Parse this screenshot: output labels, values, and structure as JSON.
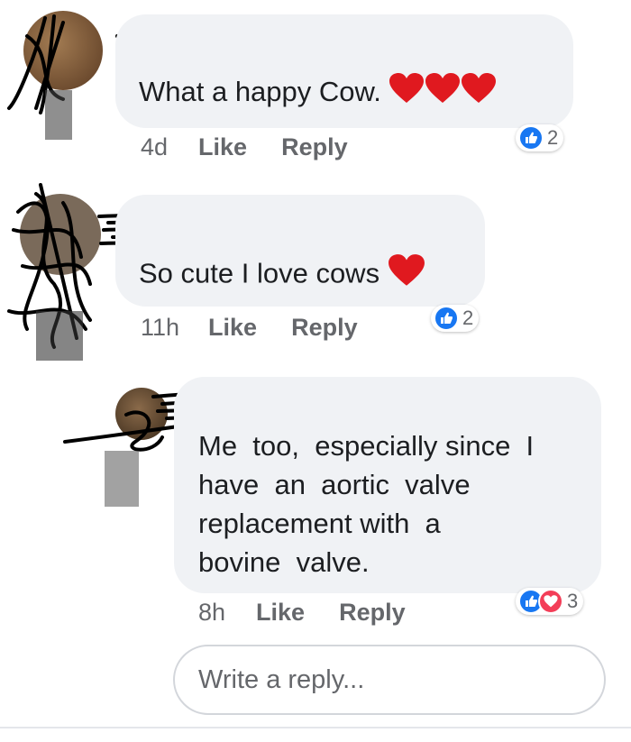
{
  "comments": [
    {
      "text": "What a happy Cow.",
      "time": "4d",
      "like_label": "Like",
      "reply_label": "Reply",
      "reaction_count": "2",
      "inline_hearts": 3
    },
    {
      "text": "So cute I love cows",
      "time": "11h",
      "like_label": "Like",
      "reply_label": "Reply",
      "reaction_count": "2",
      "inline_hearts": 1
    },
    {
      "text_lines": [
        "Me  too,  especially since  I",
        "have  an  aortic  valve",
        "replacement with  a",
        "bovine  valve."
      ],
      "time": "8h",
      "like_label": "Like",
      "reply_label": "Reply",
      "reaction_count": "3"
    }
  ],
  "reply_box": {
    "placeholder": "Write a reply..."
  },
  "colors": {
    "bubble": "#f0f2f5",
    "like_blue": "#1877f2",
    "love_red": "#f33e58",
    "meta_gray": "#65676b",
    "heart_red": "#e0191f"
  },
  "icons": [
    "thumbs-up-icon",
    "heart-icon",
    "heart-emoji-icon"
  ]
}
